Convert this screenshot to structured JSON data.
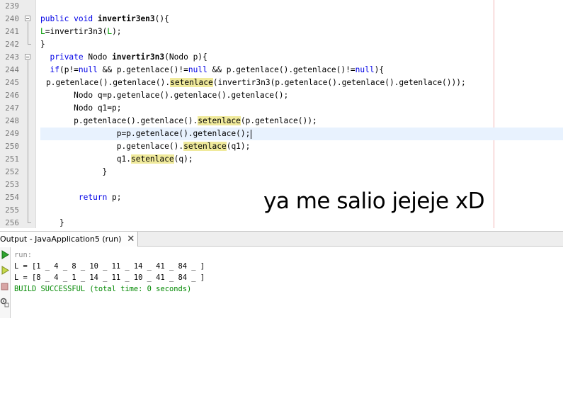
{
  "editor": {
    "lines": [
      {
        "num": "239",
        "parts": []
      },
      {
        "num": "240",
        "fold": "start",
        "parts": [
          [
            "kw",
            "public void "
          ],
          [
            "b",
            "invertir3en3"
          ],
          [
            "",
            "(){"
          ]
        ]
      },
      {
        "num": "241",
        "parts": [
          [
            "gr",
            "L"
          ],
          [
            "",
            "=invertir3n3("
          ],
          [
            "gr",
            "L"
          ],
          [
            "",
            ");"
          ]
        ]
      },
      {
        "num": "242",
        "fold": "end",
        "parts": [
          [
            "",
            "}"
          ]
        ]
      },
      {
        "num": "243",
        "fold": "start",
        "parts": [
          [
            "",
            "  "
          ],
          [
            "kw",
            "private "
          ],
          [
            "",
            "Nodo "
          ],
          [
            "b",
            "invertir3n3"
          ],
          [
            "",
            "(Nodo p){"
          ]
        ]
      },
      {
        "num": "244",
        "parts": [
          [
            "",
            "  "
          ],
          [
            "kw",
            "if"
          ],
          [
            "",
            "(p!="
          ],
          [
            "kw",
            "null"
          ],
          [
            "",
            " && p.getenlace()!="
          ],
          [
            "kw",
            "null"
          ],
          [
            "",
            " && p.getenlace().getenlace()!="
          ],
          [
            "kw",
            "null"
          ],
          [
            "",
            "){"
          ]
        ]
      },
      {
        "num": "245",
        "parts": [
          [
            "",
            "p.getenlace().getenlace()."
          ],
          [
            "hl",
            "setenlace"
          ],
          [
            "",
            "(invertir3n3(p.getenlace().getenlace().getenlace()));"
          ]
        ]
      },
      {
        "num": "246",
        "parts": [
          [
            "",
            "       Nodo q=p.getenlace().getenlace().getenlace();"
          ]
        ]
      },
      {
        "num": "247",
        "parts": [
          [
            "",
            "       Nodo q1=p;"
          ]
        ]
      },
      {
        "num": "248",
        "parts": [
          [
            "",
            "       p.getenlace().getenlace()."
          ],
          [
            "hl",
            "setenlace"
          ],
          [
            "",
            "(p.getenlace());"
          ]
        ]
      },
      {
        "num": "249",
        "current": true,
        "parts": [
          [
            "",
            "                p=p.getenlace().getenlace();"
          ]
        ]
      },
      {
        "num": "250",
        "parts": [
          [
            "",
            "                p.getenlace()."
          ],
          [
            "hl",
            "setenlace"
          ],
          [
            "",
            "(q1);"
          ]
        ]
      },
      {
        "num": "251",
        "parts": [
          [
            "",
            "                q1."
          ],
          [
            "hl",
            "setenlace"
          ],
          [
            "",
            "(q);"
          ]
        ]
      },
      {
        "num": "252",
        "parts": [
          [
            "",
            "             }"
          ]
        ]
      },
      {
        "num": "253",
        "parts": []
      },
      {
        "num": "254",
        "parts": [
          [
            "",
            "        "
          ],
          [
            "kw",
            "return"
          ],
          [
            "",
            " p;"
          ]
        ]
      },
      {
        "num": "255",
        "parts": []
      },
      {
        "num": "256",
        "parts": [
          [
            "",
            "    }"
          ]
        ]
      }
    ]
  },
  "annotation": "ya me salio jejeje xD",
  "output": {
    "tab_label": "Output - JavaApplication5 (run)",
    "close_symbol": "✕",
    "lines": [
      {
        "type": "run",
        "text": "run:"
      },
      {
        "type": "normal",
        "text": "L = [1 _ 4 _ 8 _ 10 _ 11 _ 14 _ 41 _ 84 _ ]"
      },
      {
        "type": "normal",
        "text": "L = [8 _ 4 _ 1 _ 14 _ 11 _ 10 _ 41 _ 84 _ ]"
      },
      {
        "type": "success",
        "text": "BUILD SUCCESSFUL (total time: 0 seconds)"
      }
    ]
  },
  "colors": {
    "keyword": "#0000e6",
    "field": "#009900",
    "highlight": "#f0ea9c",
    "success": "#008800"
  }
}
